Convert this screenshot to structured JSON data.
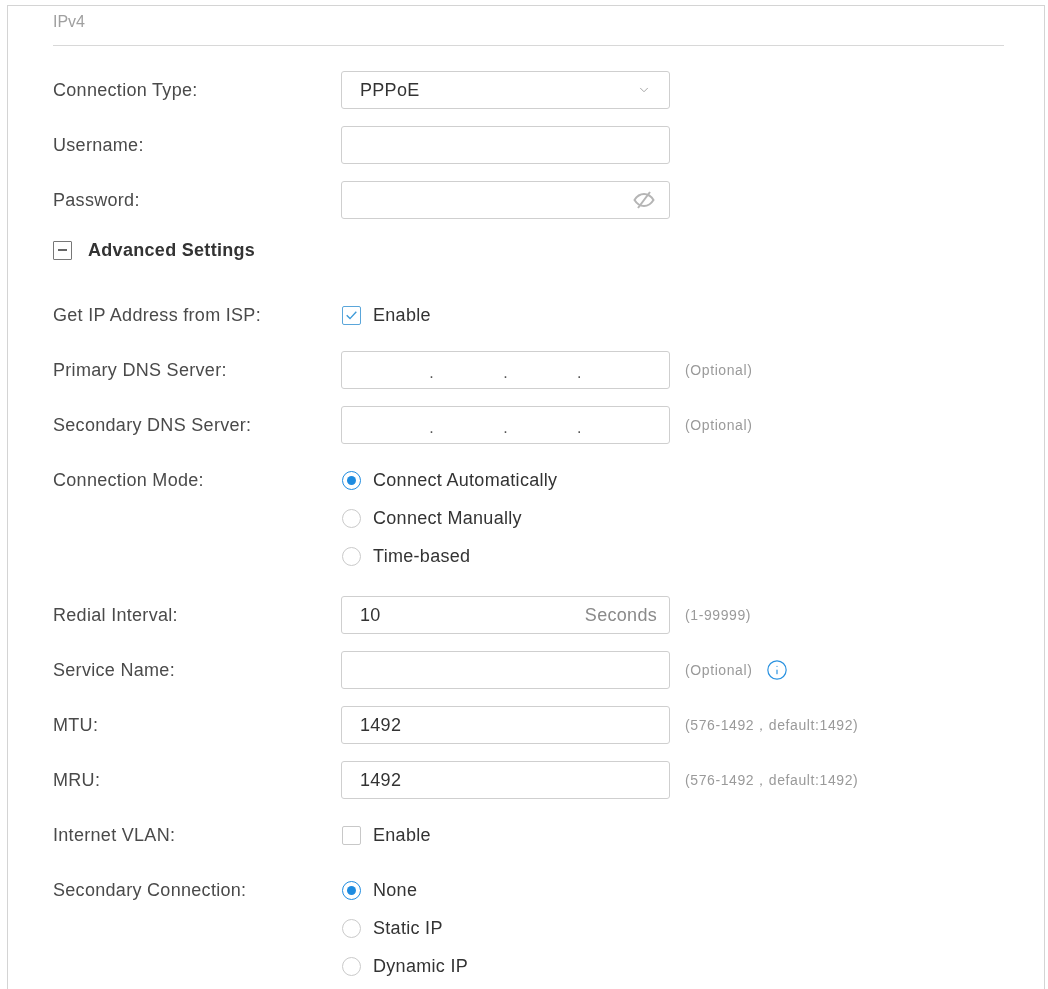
{
  "section_title": "IPv4",
  "basic_fields": [
    {
      "kind": "select",
      "label": "Connection Type:",
      "value": "PPPoE"
    },
    {
      "kind": "text",
      "label": "Username:"
    },
    {
      "kind": "password",
      "label": "Password:"
    }
  ],
  "advanced_settings": {
    "label": "Advanced Settings",
    "expanded": true
  },
  "advanced_fields": [
    {
      "kind": "checkbox",
      "label": "Get IP Address from ISP:",
      "option": "Enable",
      "checked": true
    },
    {
      "kind": "ip",
      "label": "Primary DNS Server:",
      "separators": [
        ".",
        ".",
        "."
      ],
      "hint": "(Optional)"
    },
    {
      "kind": "ip",
      "label": "Secondary DNS Server:",
      "separators": [
        ".",
        ".",
        "."
      ],
      "hint": "(Optional)"
    },
    {
      "kind": "radio",
      "label": "Connection Mode:",
      "options": [
        {
          "label": "Connect Automatically",
          "selected": true
        },
        {
          "label": "Connect Manually",
          "selected": false
        },
        {
          "label": "Time-based",
          "selected": false
        }
      ]
    },
    {
      "kind": "text",
      "label": "Redial Interval:",
      "value": "10",
      "unit": "Seconds",
      "hint": "(1-99999)"
    },
    {
      "kind": "text",
      "label": "Service Name:",
      "hint": "(Optional)",
      "info": true
    },
    {
      "kind": "text",
      "label": "MTU:",
      "value": "1492",
      "hint": "(576-1492，default:1492)"
    },
    {
      "kind": "text",
      "label": "MRU:",
      "value": "1492",
      "hint": "(576-1492，default:1492)"
    },
    {
      "kind": "checkbox",
      "label": "Internet VLAN:",
      "option": "Enable",
      "checked": false
    },
    {
      "kind": "radio",
      "label": "Secondary Connection:",
      "options": [
        {
          "label": "None",
          "selected": true
        },
        {
          "label": "Static IP",
          "selected": false
        },
        {
          "label": "Dynamic IP",
          "selected": false
        }
      ]
    }
  ]
}
